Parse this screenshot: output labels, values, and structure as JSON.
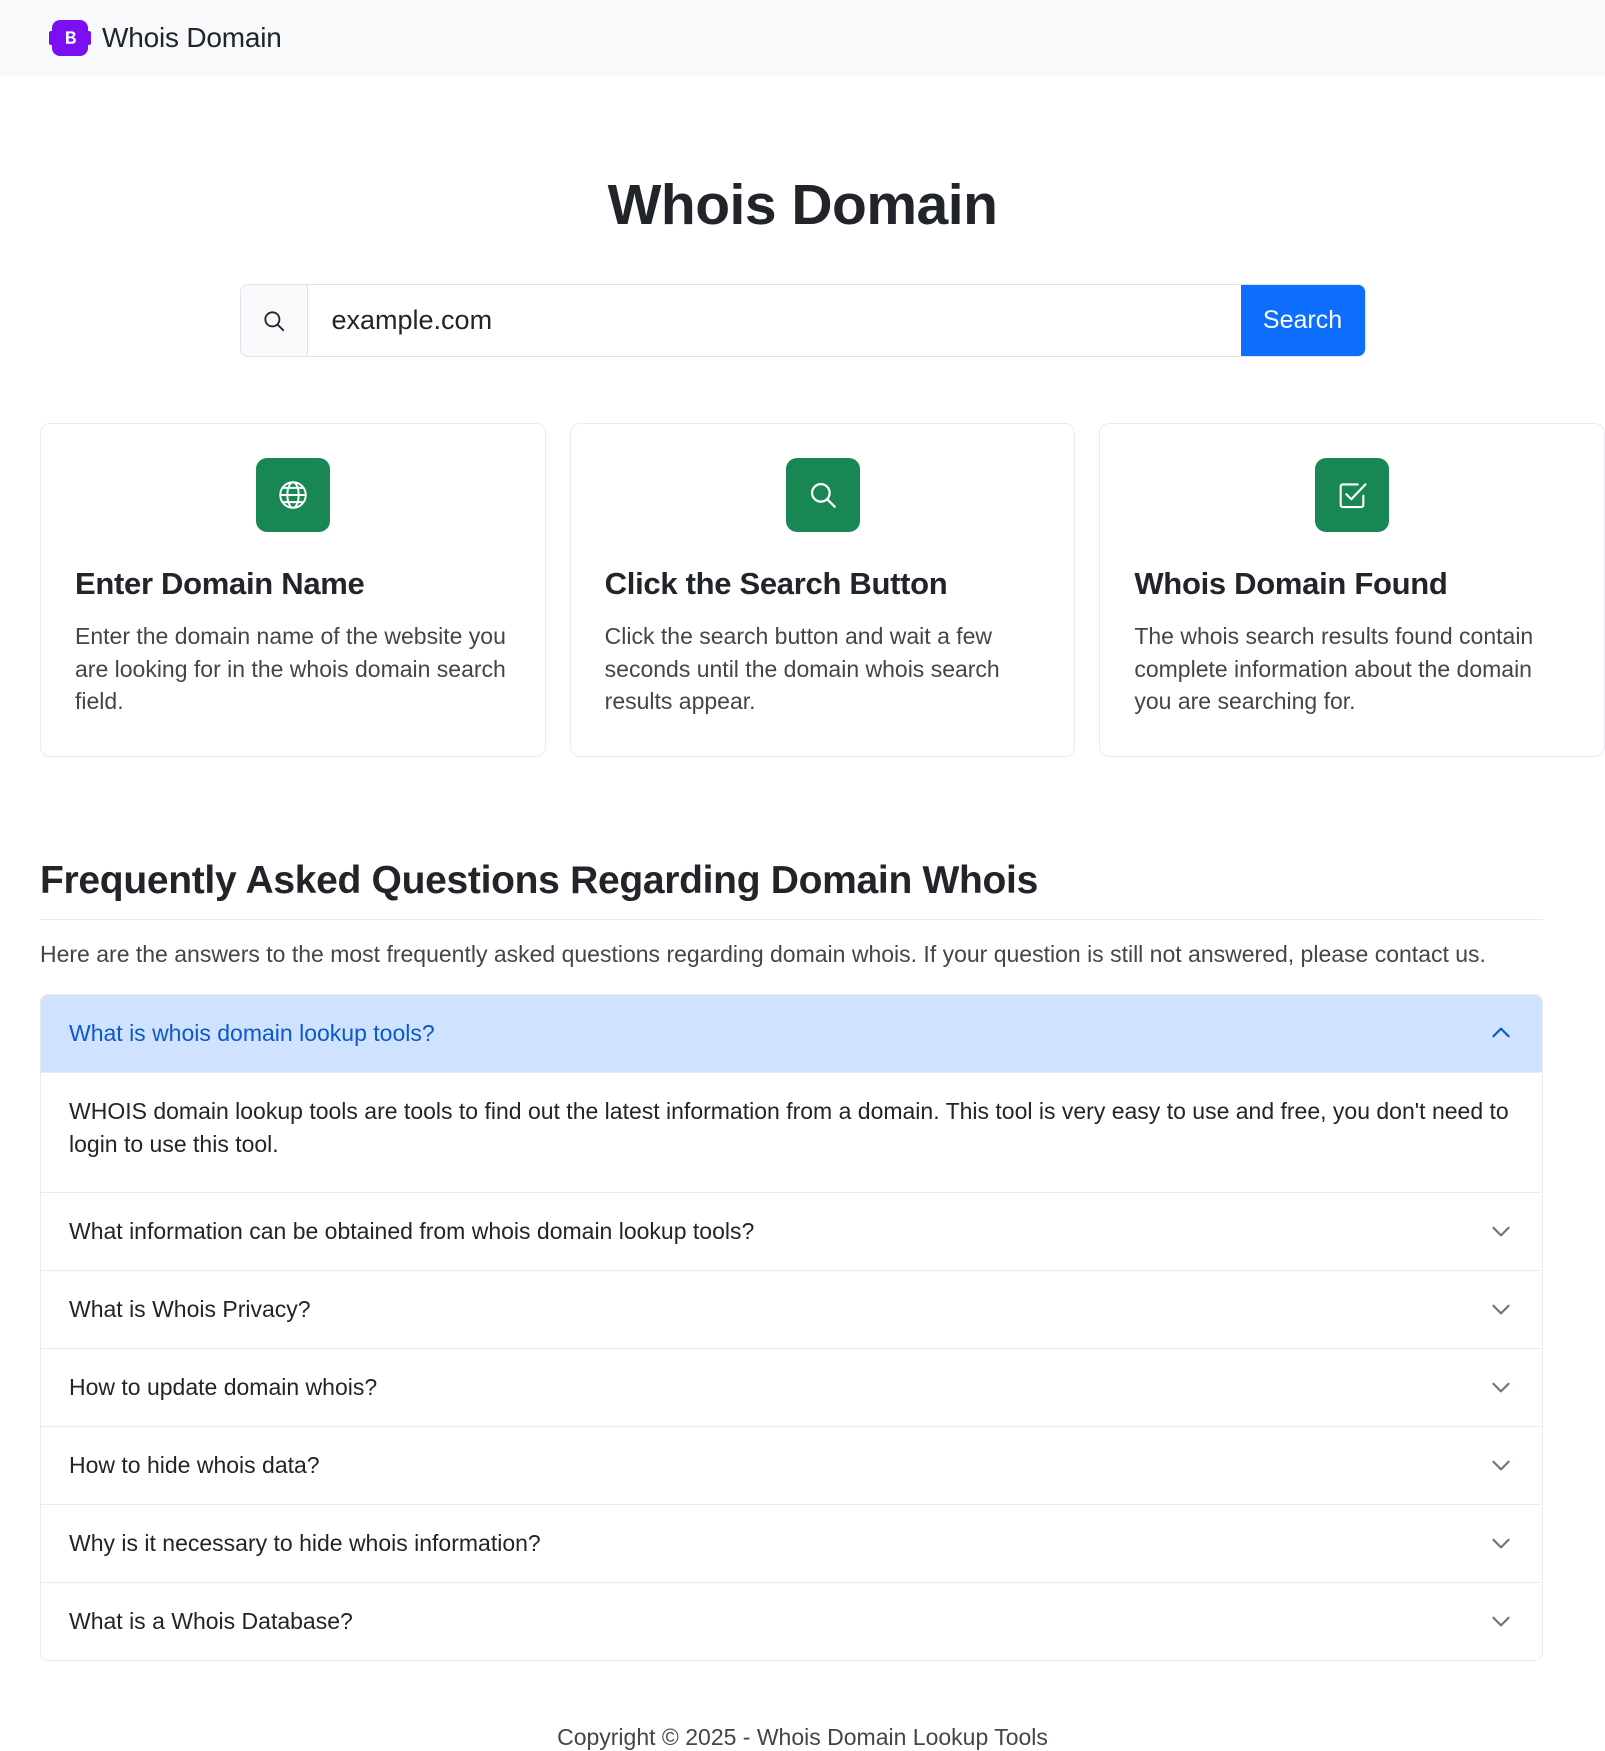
{
  "navbar": {
    "brand_label": "Whois Domain",
    "logo_letter": "B",
    "logo_color": "#7c0ff2"
  },
  "hero": {
    "title": "Whois Domain"
  },
  "search": {
    "value": "example.com",
    "placeholder": "example.com",
    "button_label": "Search",
    "button_color": "#0d6efd",
    "icon": "search-icon"
  },
  "cards": [
    {
      "icon": "globe-icon",
      "icon_color": "#198754",
      "title": "Enter Domain Name",
      "text": "Enter the domain name of the website you are looking for in the whois domain search field."
    },
    {
      "icon": "search-icon",
      "icon_color": "#198754",
      "title": "Click the Search Button",
      "text": "Click the search button and wait a few seconds until the domain whois search results appear."
    },
    {
      "icon": "check-square-icon",
      "icon_color": "#198754",
      "title": "Whois Domain Found",
      "text": "The whois search results found contain complete information about the domain you are searching for."
    }
  ],
  "faq": {
    "heading": "Frequently Asked Questions Regarding Domain Whois",
    "subtitle": "Here are the answers to the most frequently asked questions regarding domain whois. If your question is still not answered, please contact us.",
    "items": [
      {
        "question": "What is whois domain lookup tools?",
        "answer": "WHOIS domain lookup tools are tools to find out the latest information from a domain. This tool is very easy to use and free, you don't need to login to use this tool.",
        "open": true,
        "icon": "chevron-up-icon"
      },
      {
        "question": "What information can be obtained from whois domain lookup tools?",
        "answer": "",
        "open": false,
        "icon": "chevron-down-icon"
      },
      {
        "question": "What is Whois Privacy?",
        "answer": "",
        "open": false,
        "icon": "chevron-down-icon"
      },
      {
        "question": "How to update domain whois?",
        "answer": "",
        "open": false,
        "icon": "chevron-down-icon"
      },
      {
        "question": "How to hide whois data?",
        "answer": "",
        "open": false,
        "icon": "chevron-down-icon"
      },
      {
        "question": "Why is it necessary to hide whois information?",
        "answer": "",
        "open": false,
        "icon": "chevron-down-icon"
      },
      {
        "question": "What is a Whois Database?",
        "answer": "",
        "open": false,
        "icon": "chevron-down-icon"
      }
    ]
  },
  "footer": {
    "copyright": "Copyright © 2025 - Whois Domain Lookup Tools"
  }
}
